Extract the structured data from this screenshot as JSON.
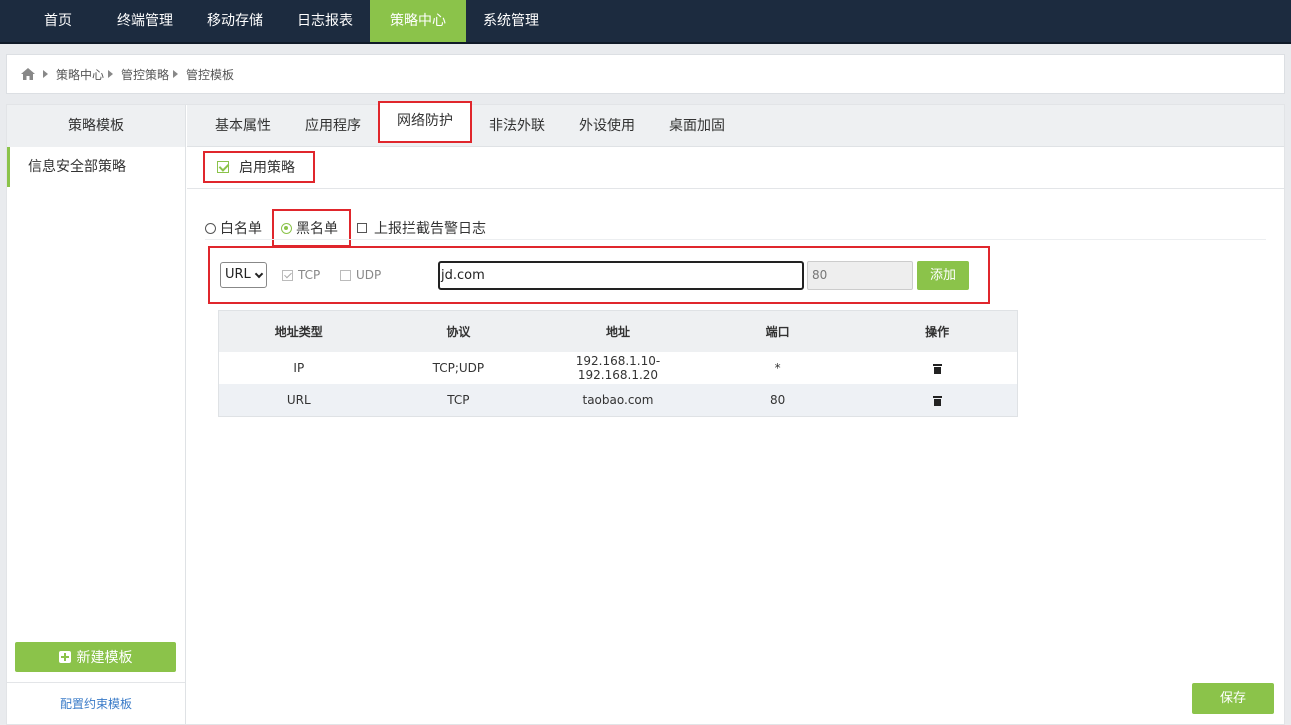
{
  "topnav": {
    "items": [
      {
        "label": "首页"
      },
      {
        "label": "终端管理"
      },
      {
        "label": "移动存储"
      },
      {
        "label": "日志报表"
      },
      {
        "label": "策略中心",
        "active": true
      },
      {
        "label": "系统管理"
      }
    ]
  },
  "breadcrumb": [
    "策略中心",
    "管控策略",
    "管控模板"
  ],
  "sidebar": {
    "title": "策略模板",
    "items": [
      "信息安全部策略"
    ],
    "new_button": "新建模板",
    "bottom_link": "配置约束模板"
  },
  "tabs": [
    "基本属性",
    "应用程序",
    "网络防护",
    "非法外联",
    "外设使用",
    "桌面加固"
  ],
  "enable_label": "启用策略",
  "mode": {
    "whitelist": "白名单",
    "blacklist": "黑名单",
    "report_label": "上报拦截告警日志"
  },
  "rule_form": {
    "type_value": "URL",
    "tcp_label": "TCP",
    "udp_label": "UDP",
    "address_value": "jd.com",
    "port_placeholder": "80",
    "add_label": "添加"
  },
  "table": {
    "headers": [
      "地址类型",
      "协议",
      "地址",
      "端口",
      "操作"
    ],
    "rows": [
      {
        "type": "IP",
        "protocol": "TCP;UDP",
        "address": "192.168.1.10-192.168.1.20",
        "port": "*"
      },
      {
        "type": "URL",
        "protocol": "TCP",
        "address": "taobao.com",
        "port": "80"
      }
    ]
  },
  "save_label": "保存",
  "colors": {
    "accent": "#8bc34a",
    "nav_bg": "#1c2b3f",
    "highlight": "#e0262c"
  }
}
